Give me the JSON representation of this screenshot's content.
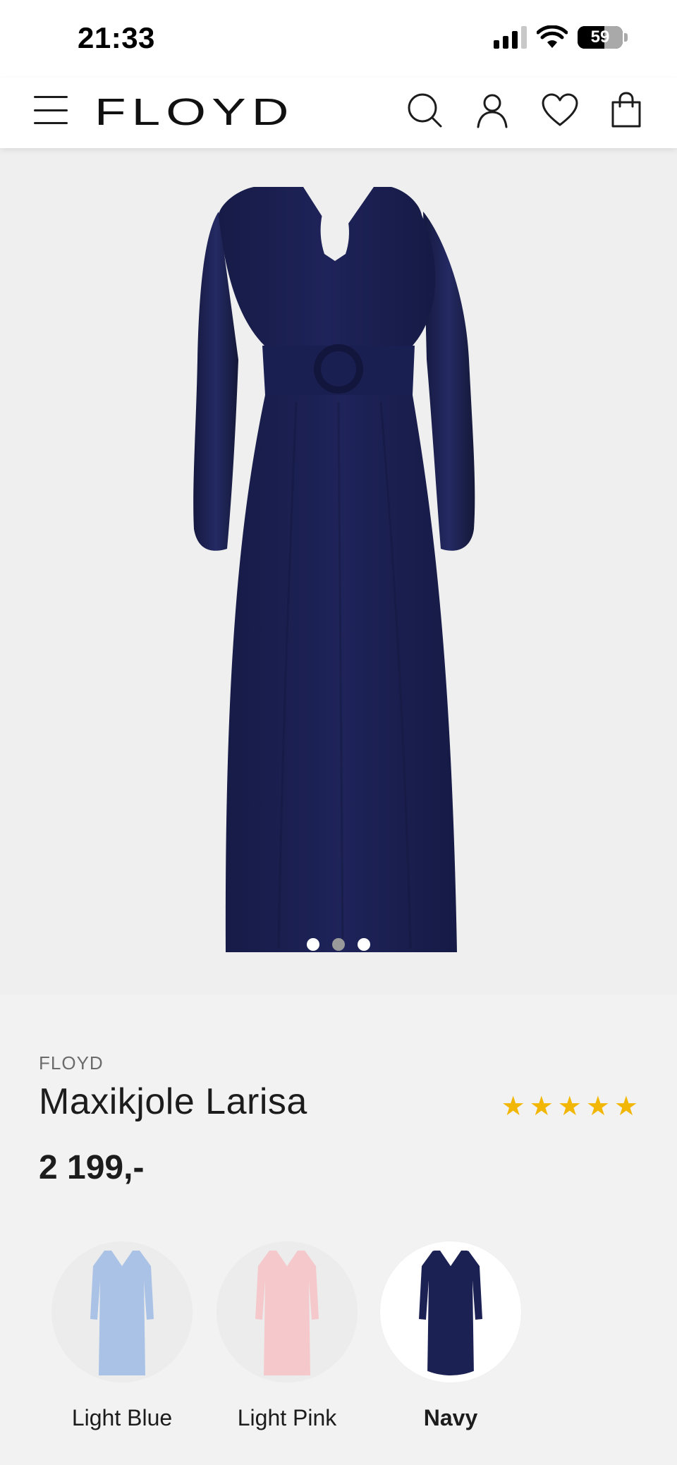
{
  "status_bar": {
    "time": "21:33",
    "battery_percent": "59",
    "battery_level": 0.59,
    "signal_bars": 3,
    "signal_icon": "signal-icon",
    "wifi_icon": "wifi-icon"
  },
  "header": {
    "logo": "FLOYD",
    "icons": {
      "menu": "menu-icon",
      "search": "search-icon",
      "account": "user-icon",
      "wishlist": "heart-icon",
      "cart": "shopping-bag-icon"
    }
  },
  "gallery": {
    "image_count": 3,
    "active_index": 1,
    "dress_color": "#1c2154"
  },
  "product": {
    "brand": "FLOYD",
    "name": "Maxikjole Larisa",
    "rating": 5,
    "rating_max": 5,
    "price": "2 199,-"
  },
  "colors": {
    "star": "#f2b705",
    "background": "#f2f2f2"
  },
  "swatches": [
    {
      "label": "Light Blue",
      "color": "#a9c2e6",
      "selected": false
    },
    {
      "label": "Light Pink",
      "color": "#f5c9cc",
      "selected": false
    },
    {
      "label": "Navy",
      "color": "#1c2154",
      "selected": true
    }
  ]
}
